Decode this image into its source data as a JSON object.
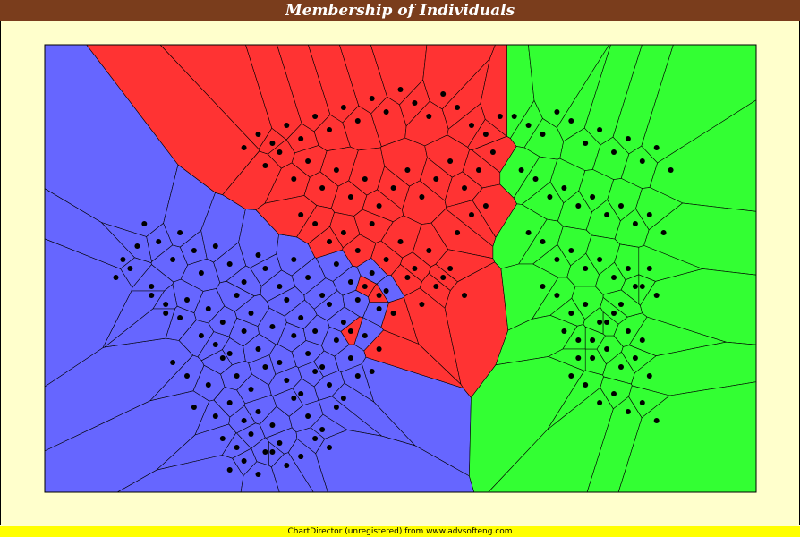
{
  "title": "Membership of Individuals",
  "footer_text": "ChartDirector (unregistered) from www.advsofteng.com",
  "colors": {
    "title_bg": "#7a3d1c",
    "page_bg": "#ffffcc",
    "footer_bg": "#ffff00",
    "group_a": "#6666ff",
    "group_b": "#ff3333",
    "group_c": "#33ff33",
    "point": "#000000",
    "cell_edge": "#000000"
  },
  "chart_data": {
    "type": "scatter",
    "title": "Membership of Individuals",
    "xlabel": "",
    "ylabel": "",
    "xlim": [
      0,
      100
    ],
    "ylim": [
      0,
      100
    ],
    "grid": false,
    "legend": "none",
    "series": [
      {
        "color": "#6666ff",
        "x": [
          14,
          16,
          18,
          19,
          21,
          22,
          24,
          26,
          28,
          30,
          31,
          33,
          35,
          37,
          39,
          41,
          43,
          44,
          46,
          48,
          20,
          23,
          25,
          27,
          29,
          32,
          34,
          36,
          38,
          40,
          42,
          45,
          47,
          15,
          17,
          19,
          22,
          24,
          26,
          28,
          30,
          33,
          35,
          37,
          39,
          41,
          43,
          46,
          18,
          20,
          23,
          25,
          27,
          29,
          31,
          34,
          36,
          38,
          40,
          42,
          44,
          21,
          24,
          26,
          28,
          30,
          32,
          35,
          37,
          39,
          41,
          25,
          27,
          29,
          31,
          33,
          36,
          38,
          40,
          26,
          28,
          30,
          32,
          34,
          36,
          13,
          12,
          15,
          17,
          10,
          11
        ],
        "y": [
          60,
          56,
          52,
          58,
          54,
          49,
          55,
          51,
          47,
          53,
          50,
          46,
          52,
          48,
          44,
          51,
          47,
          43,
          49,
          45,
          43,
          41,
          38,
          44,
          40,
          37,
          43,
          39,
          36,
          42,
          38,
          35,
          41,
          46,
          42,
          39,
          35,
          33,
          31,
          36,
          32,
          29,
          35,
          31,
          28,
          34,
          30,
          27,
          29,
          26,
          24,
          30,
          26,
          23,
          28,
          25,
          22,
          27,
          24,
          21,
          26,
          19,
          17,
          20,
          16,
          18,
          15,
          21,
          17,
          14,
          19,
          12,
          10,
          13,
          9,
          11,
          8,
          12,
          10,
          5,
          7,
          4,
          9,
          6,
          8,
          55,
          50,
          44,
          40,
          48,
          52
        ]
      },
      {
        "color": "#ff3333",
        "x": [
          28,
          30,
          32,
          34,
          36,
          38,
          40,
          42,
          44,
          46,
          48,
          50,
          52,
          54,
          56,
          58,
          60,
          62,
          64,
          31,
          33,
          35,
          37,
          39,
          41,
          43,
          45,
          47,
          49,
          51,
          53,
          55,
          57,
          59,
          61,
          63,
          36,
          38,
          40,
          42,
          44,
          46,
          48,
          50,
          52,
          54,
          56,
          58,
          60,
          62,
          45,
          47,
          49,
          51,
          53,
          55,
          57,
          59,
          43,
          47
        ],
        "y": [
          77,
          80,
          78,
          82,
          79,
          84,
          81,
          86,
          83,
          88,
          85,
          90,
          87,
          84,
          89,
          86,
          82,
          80,
          84,
          73,
          76,
          70,
          74,
          68,
          72,
          66,
          70,
          64,
          68,
          72,
          66,
          70,
          74,
          68,
          72,
          76,
          62,
          60,
          56,
          58,
          54,
          60,
          52,
          56,
          50,
          54,
          48,
          58,
          62,
          64,
          46,
          44,
          40,
          48,
          42,
          46,
          50,
          44,
          36,
          32
        ]
      },
      {
        "color": "#33ff33",
        "x": [
          66,
          68,
          70,
          72,
          74,
          76,
          78,
          80,
          82,
          84,
          86,
          88,
          67,
          69,
          71,
          73,
          75,
          77,
          79,
          81,
          83,
          85,
          87,
          68,
          70,
          72,
          74,
          76,
          78,
          80,
          82,
          84,
          86,
          70,
          72,
          74,
          76,
          78,
          80,
          82,
          84,
          73,
          75,
          77,
          79,
          81,
          83,
          85,
          74,
          76,
          78,
          80,
          82,
          84,
          86,
          75,
          77,
          79,
          81,
          83,
          85
        ],
        "y": [
          84,
          82,
          80,
          85,
          83,
          78,
          81,
          76,
          79,
          74,
          77,
          72,
          72,
          70,
          66,
          68,
          64,
          66,
          62,
          64,
          60,
          62,
          58,
          58,
          56,
          52,
          54,
          50,
          52,
          48,
          50,
          46,
          44,
          46,
          44,
          40,
          42,
          38,
          40,
          36,
          34,
          36,
          34,
          30,
          32,
          28,
          30,
          26,
          26,
          24,
          20,
          22,
          18,
          20,
          16,
          30,
          34,
          38,
          42,
          46,
          50
        ]
      }
    ]
  }
}
